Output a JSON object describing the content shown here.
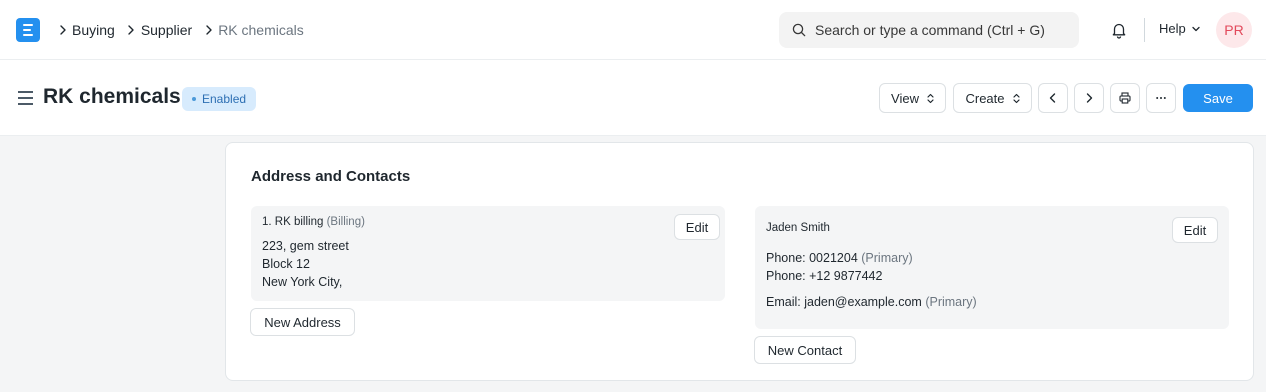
{
  "navbar": {
    "breadcrumbs": [
      "Buying",
      "Supplier",
      "RK chemicals"
    ],
    "search_placeholder": "Search or type a command (Ctrl + G)",
    "help_label": "Help",
    "avatar_initials": "PR"
  },
  "page_head": {
    "title": "RK chemicals",
    "status": "Enabled",
    "view_label": "View",
    "create_label": "Create",
    "save_label": "Save"
  },
  "section": {
    "title": "Address and Contacts",
    "address": {
      "name": "1. RK billing",
      "type": "(Billing)",
      "lines": [
        "223, gem street",
        "Block 12",
        "New York City,"
      ],
      "edit_label": "Edit"
    },
    "new_address_label": "New Address",
    "contact": {
      "name": "Jaden Smith",
      "phone1_label": "Phone:",
      "phone1": "0021204",
      "phone1_tag": "(Primary)",
      "phone2_label": "Phone:",
      "phone2": "+12 9877442",
      "email_label": "Email:",
      "email": "jaden@example.com",
      "email_tag": "(Primary)",
      "edit_label": "Edit"
    },
    "new_contact_label": "New Contact"
  },
  "colors": {
    "accent": "#2490ef",
    "badge_bg": "#d7ebfd",
    "badge_text": "#2d6fb3",
    "avatar_bg": "#fde8ea",
    "avatar_text": "#e2495b"
  }
}
